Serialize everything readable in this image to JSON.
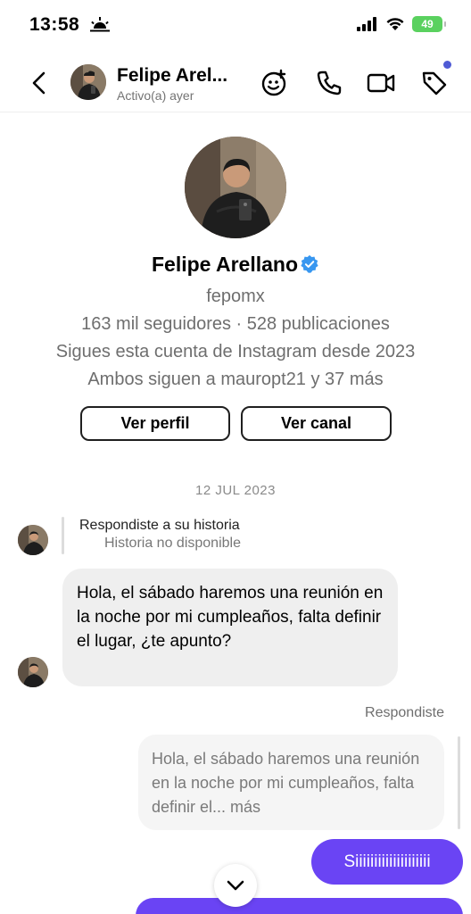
{
  "status_bar": {
    "time": "13:58",
    "battery": "49"
  },
  "header": {
    "name": "Felipe Arel...",
    "status": "Activo(a) ayer"
  },
  "profile": {
    "name": "Felipe Arellano",
    "username": "fepomx",
    "stats": "163 mil seguidores · 528 publicaciones",
    "following_since": "Sigues esta cuenta de Instagram desde 2023",
    "mutual": "Ambos siguen a mauropt21 y 37 más",
    "view_profile_label": "Ver perfil",
    "view_channel_label": "Ver canal"
  },
  "conversation": {
    "date": "12 JUL 2023",
    "story_reply_title": "Respondiste a su historia",
    "story_reply_subtitle": "Historia no disponible",
    "incoming_message": "Hola, el sábado haremos una reunión en la noche por mi cumpleaños, falta definir el lugar, ¿te apunto?",
    "reply_label": "Respondiste",
    "quoted_message": "Hola, el sábado haremos una reunión en la noche por mi cumpleaños, falta definir el... más",
    "outgoing_message": "Siiiiiiiiiiiiiiiiiiii"
  },
  "colors": {
    "accent": "#6a44f4",
    "verified": "#3897f0",
    "battery": "#5ad15f",
    "notification_dot": "#4f5bd5"
  },
  "icons": [
    "sun-icon",
    "signal-icon",
    "wifi-icon",
    "battery-icon",
    "back-arrow-icon",
    "effects-icon",
    "phone-icon",
    "video-icon",
    "tag-icon",
    "verified-icon",
    "chevron-down-icon"
  ]
}
